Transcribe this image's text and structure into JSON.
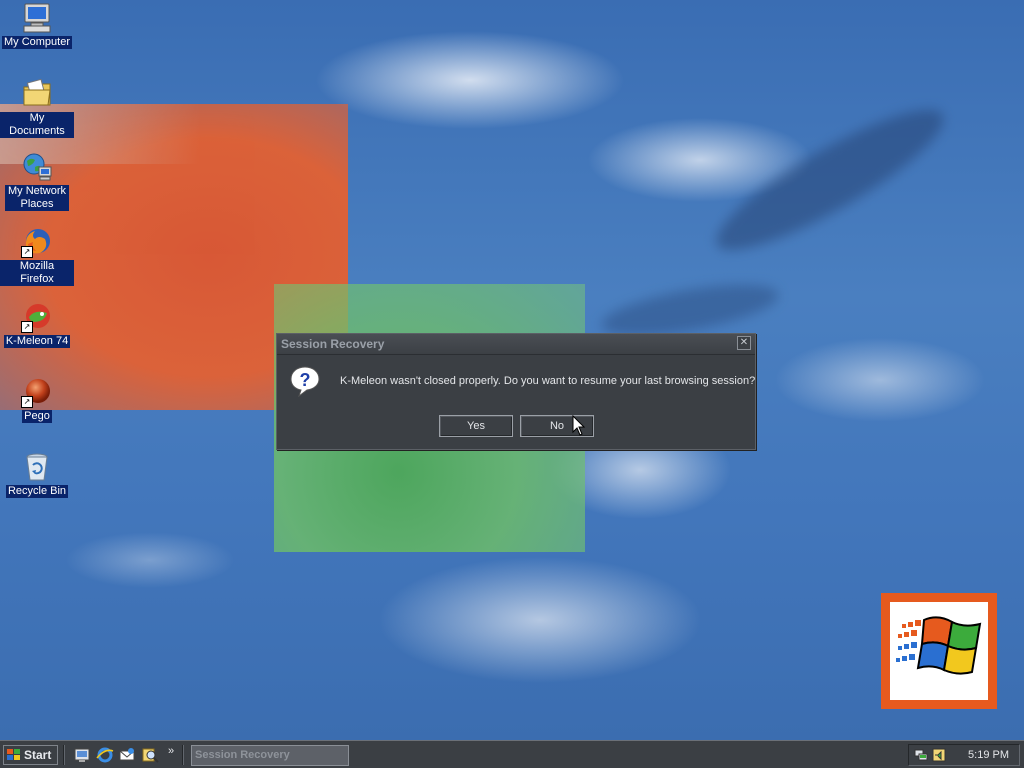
{
  "desktop": {
    "icons": [
      {
        "label": "My Computer",
        "icon": "computer-icon"
      },
      {
        "label": "My Documents",
        "icon": "documents-folder-icon"
      },
      {
        "label": "My Network",
        "label2": "Places",
        "icon": "network-icon"
      },
      {
        "label": "Mozilla Firefox",
        "icon": "firefox-icon"
      },
      {
        "label": "K-Meleon 74",
        "icon": "kmeleon-icon"
      },
      {
        "label": "Pego",
        "icon": "pego-icon"
      },
      {
        "label": "Recycle Bin",
        "icon": "recycle-bin-icon"
      }
    ]
  },
  "dialog": {
    "title": "Session Recovery",
    "close_glyph": "✕",
    "message": "K-Meleon wasn't closed properly. Do you want to resume your last browsing session?",
    "yes_label": "Yes",
    "no_label": "No",
    "icon": "question-icon"
  },
  "taskbar": {
    "start_label": "Start",
    "quick_launch_more": "»",
    "tasks": [
      {
        "label": "Session Recovery"
      }
    ],
    "clock": "5:19 PM"
  },
  "colors": {
    "desktop_blue": "#4a7fc0",
    "dialog_bg": "#3b3f44",
    "selection_blue": "#0a246a",
    "orange": "#e8602e",
    "green": "#6cbc6a"
  }
}
